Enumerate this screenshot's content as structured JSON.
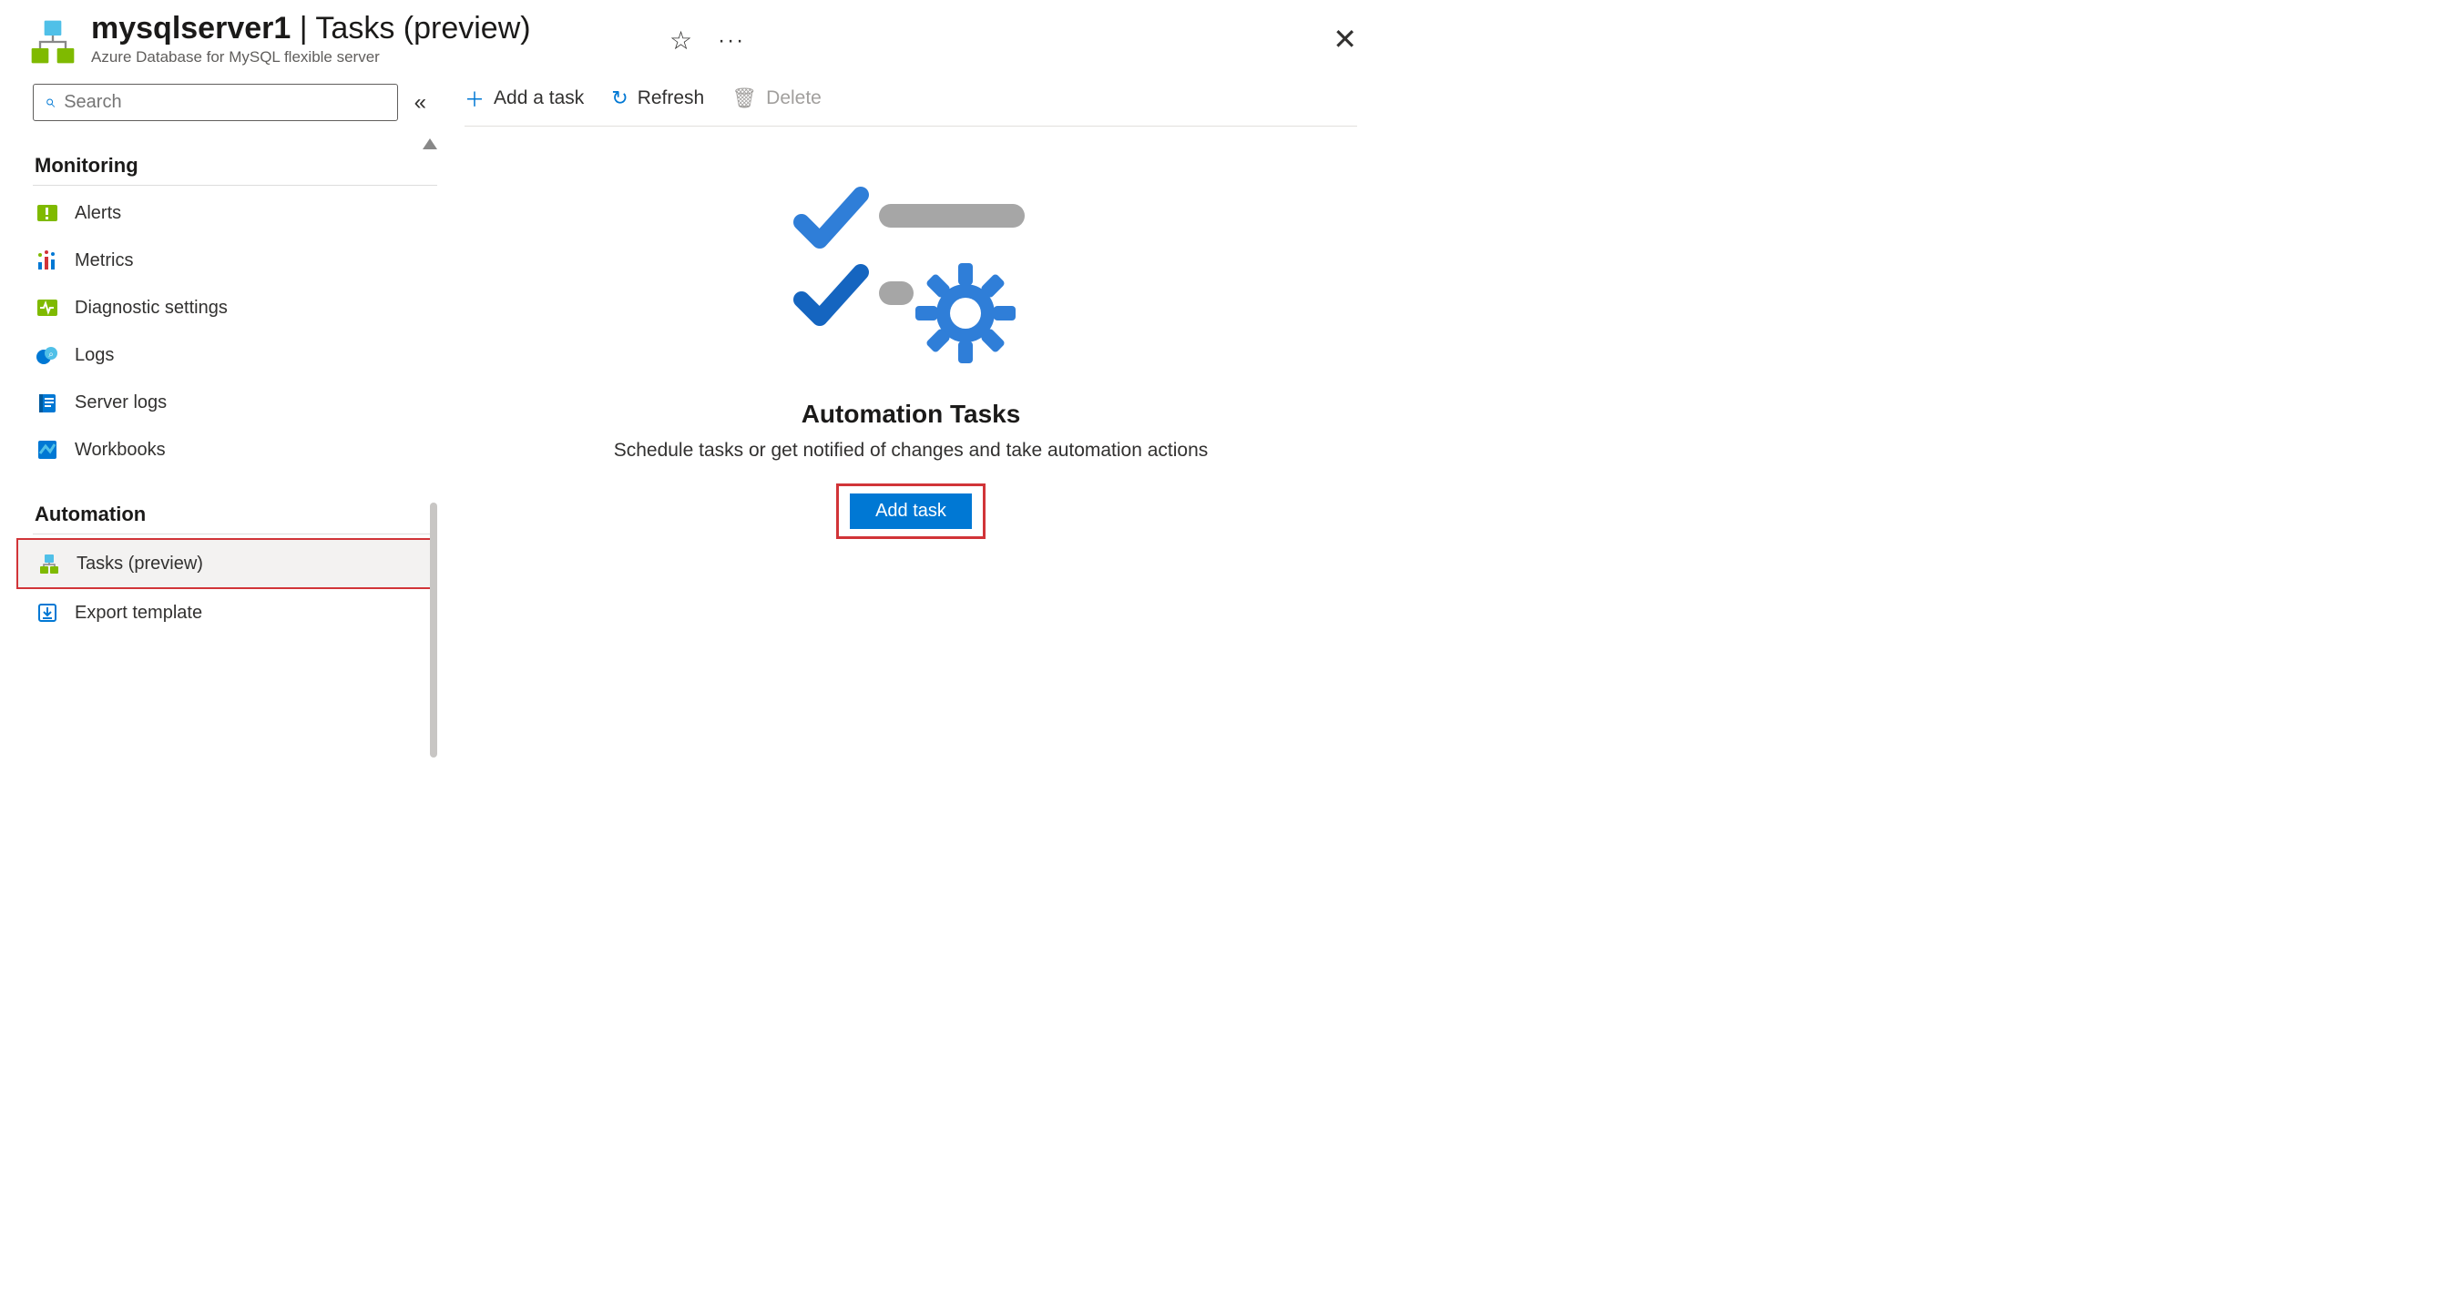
{
  "header": {
    "resource_name": "mysqlserver1",
    "page_name": "Tasks (preview)",
    "subtitle": "Azure Database for MySQL flexible server"
  },
  "search": {
    "placeholder": "Search"
  },
  "nav": {
    "sections": [
      {
        "title": "Monitoring",
        "items": [
          {
            "label": "Alerts",
            "icon": "alerts"
          },
          {
            "label": "Metrics",
            "icon": "metrics"
          },
          {
            "label": "Diagnostic settings",
            "icon": "diagnostic"
          },
          {
            "label": "Logs",
            "icon": "logs"
          },
          {
            "label": "Server logs",
            "icon": "serverlogs"
          },
          {
            "label": "Workbooks",
            "icon": "workbooks"
          }
        ]
      },
      {
        "title": "Automation",
        "items": [
          {
            "label": "Tasks (preview)",
            "icon": "tasks",
            "selected": true
          },
          {
            "label": "Export template",
            "icon": "export"
          }
        ]
      }
    ]
  },
  "toolbar": {
    "add_label": "Add a task",
    "refresh_label": "Refresh",
    "delete_label": "Delete"
  },
  "empty": {
    "title": "Automation Tasks",
    "description": "Schedule tasks or get notified of changes and take automation actions",
    "button": "Add task"
  }
}
